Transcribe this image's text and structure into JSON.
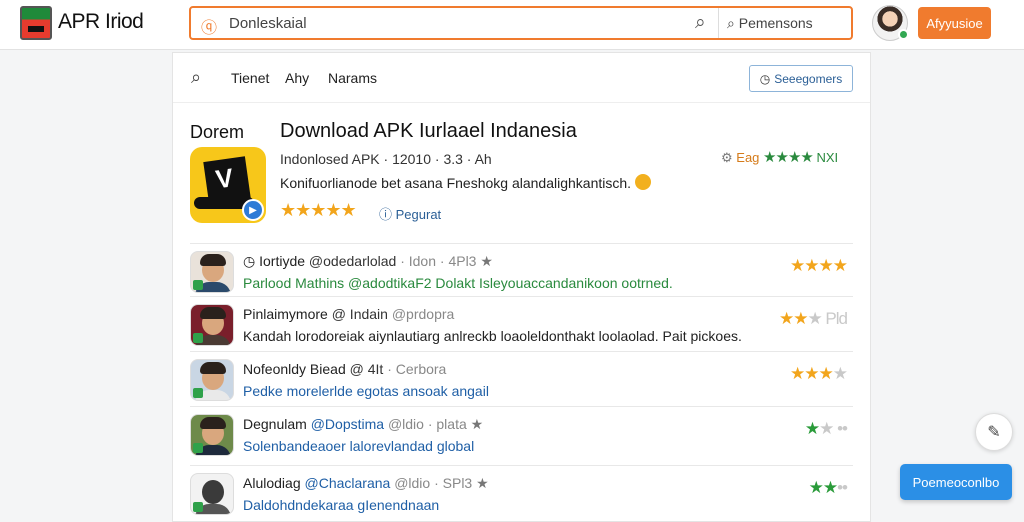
{
  "topbar": {
    "brand": "APR Iriod",
    "search_placeholder": "Donleskaial",
    "filter_label": "Pemensons",
    "action_button": "Afyyusioe"
  },
  "nav": {
    "links": [
      "Tienet",
      "Ahy",
      "Narams"
    ],
    "button": "Seeegomers"
  },
  "app": {
    "section_label": "Dorem",
    "title": "Download APK Iurlaael Indanesia",
    "meta": "Indonlosed APK · 12010 · 3.3 · Ah",
    "description": "Konifuorlianode bet asana Fneshokg alandalighkantisch.",
    "stars": "★★★★★",
    "rating_link": "Pegurat",
    "badge_label": "Eag",
    "badge_stars": "★★★★",
    "badge_suffix": "NXI"
  },
  "reviews": [
    {
      "name": "Iortiyde",
      "handle": "@odedarlolad",
      "meta": "· Idon · 4Pl3",
      "text": "Parlood Mathins @adodtikaF2 Dolakt Isleyouaccandanikoon ootrned.",
      "stars_filled": "★★★★",
      "stars_empty": "",
      "star_color": "orange"
    },
    {
      "name": "Pinlaimymore",
      "handle": "@ Indain",
      "meta": "@prdopra",
      "text": "Kandah lorodoreiak aiynlautiarg anlreckb loaoleldonthakt loolaolad.  Pait pickoes.",
      "stars_filled": "★★",
      "stars_empty": "★ Pld",
      "star_color": "orange"
    },
    {
      "name": "Nofeonldy Biead",
      "handle": "@ 4It",
      "meta": "· Cerbora",
      "text": "Pedke morelerlde egotas ansoak angail",
      "stars_filled": "★★★",
      "stars_empty": "★",
      "star_color": "orange"
    },
    {
      "name": "Degnulam",
      "handle": "@Dopstima",
      "meta": "@ldio · plata",
      "text": "Solenbandeaoer lalorevlandad global",
      "stars_filled": "★",
      "stars_empty": "★ ••",
      "star_color": "green"
    },
    {
      "name": "Alulodiag",
      "handle": "@Chaclarana",
      "meta": "@ldio · SPl3",
      "text": "Daldohdndekaraa gIenendnaan",
      "stars_filled": "★★",
      "stars_empty": "••",
      "star_color": "green"
    }
  ],
  "floating": {
    "edit_icon": "pencil-icon",
    "button": "Poemeoconlbo"
  },
  "colors": {
    "accent": "#f07b2e",
    "link": "#1f5fa6",
    "star": "#f2a51c",
    "green": "#2a8a3e",
    "primary_button": "#2b8fe6"
  }
}
